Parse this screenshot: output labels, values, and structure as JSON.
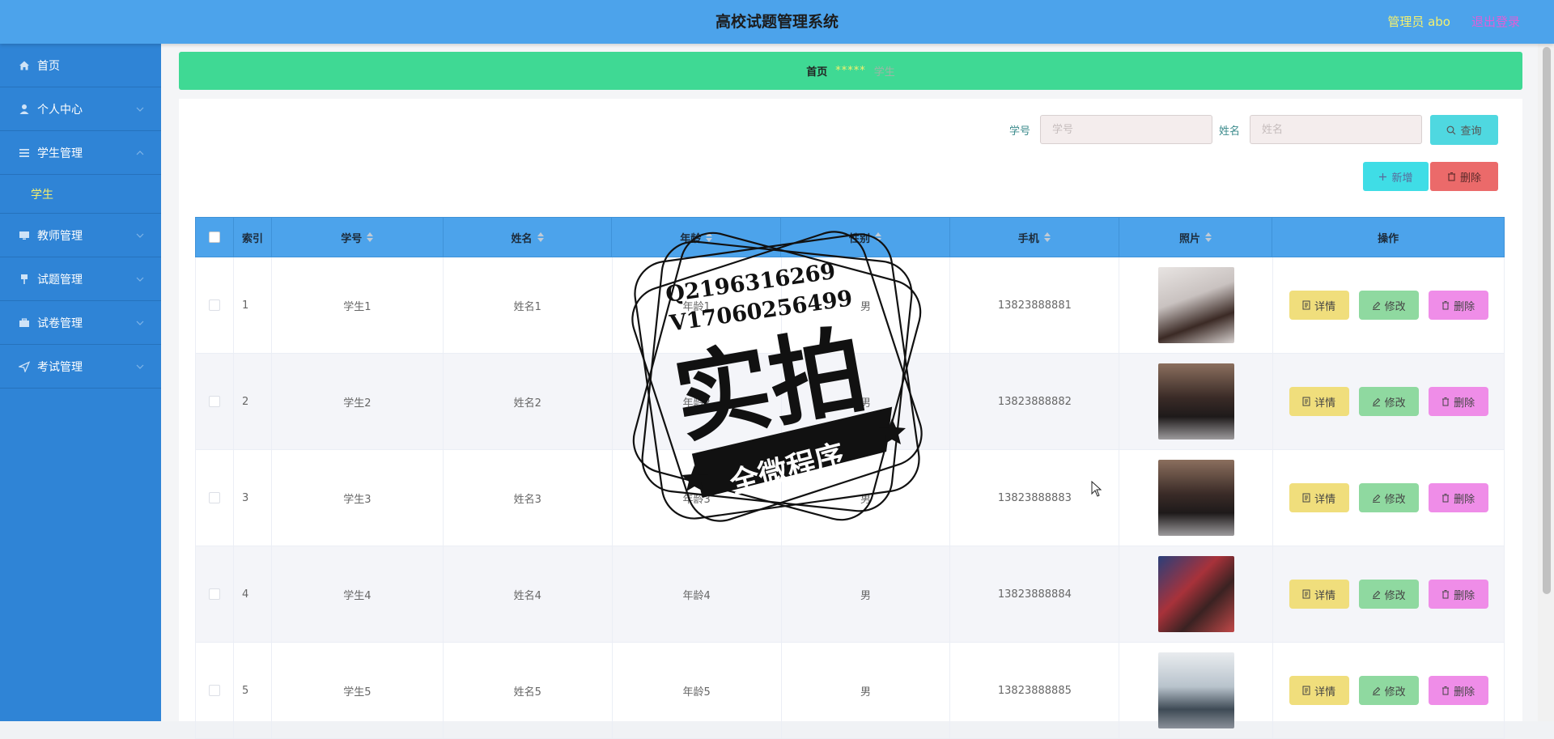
{
  "header": {
    "title": "高校试题管理系统",
    "user": "管理员 abo",
    "logout": "退出登录"
  },
  "sidebar": {
    "items": [
      {
        "label": "首页",
        "icon": "home-icon"
      },
      {
        "label": "个人中心",
        "icon": "user-icon"
      },
      {
        "label": "学生管理",
        "icon": "list-icon",
        "sub": "学生"
      },
      {
        "label": "教师管理",
        "icon": "monitor-icon"
      },
      {
        "label": "试题管理",
        "icon": "pin-icon"
      },
      {
        "label": "试卷管理",
        "icon": "briefcase-icon"
      },
      {
        "label": "考试管理",
        "icon": "send-icon"
      }
    ]
  },
  "breadcrumb": {
    "home": "首页",
    "sep": "*****",
    "current": "学生"
  },
  "search": {
    "id_label": "学号",
    "id_placeholder": "学号",
    "name_label": "姓名",
    "name_placeholder": "姓名",
    "query": "查询",
    "add": "新增",
    "delete": "删除"
  },
  "table": {
    "headers": [
      "索引",
      "学号",
      "姓名",
      "年龄",
      "性别",
      "手机",
      "照片",
      "操作"
    ],
    "rows": [
      {
        "index": "1",
        "id": "学生1",
        "name": "姓名1",
        "age": "年龄1",
        "gender": "男",
        "phone": "13823888881"
      },
      {
        "index": "2",
        "id": "学生2",
        "name": "姓名2",
        "age": "年龄2",
        "gender": "男",
        "phone": "13823888882"
      },
      {
        "index": "3",
        "id": "学生3",
        "name": "姓名3",
        "age": "年龄3",
        "gender": "男",
        "phone": "13823888883"
      },
      {
        "index": "4",
        "id": "学生4",
        "name": "姓名4",
        "age": "年龄4",
        "gender": "男",
        "phone": "13823888884"
      },
      {
        "index": "5",
        "id": "学生5",
        "name": "姓名5",
        "age": "年龄5",
        "gender": "男",
        "phone": "13823888885"
      }
    ],
    "actions": {
      "detail": "详情",
      "edit": "修改",
      "delete": "删除"
    }
  },
  "stamp": {
    "line1": "Q2196316269",
    "line2": "V17060256499",
    "main": "实拍",
    "ribbon": "全微程序"
  },
  "colors": {
    "header": "#4ca3eb",
    "sidebar": "#2f84d6",
    "breadcrumb": "#3fd994",
    "query": "#4fd8e0",
    "add": "#3fdde6",
    "delete": "#eb6a6a",
    "detail": "#f0de7c",
    "edit": "#8fd9a0",
    "row_delete": "#ef8de8"
  }
}
